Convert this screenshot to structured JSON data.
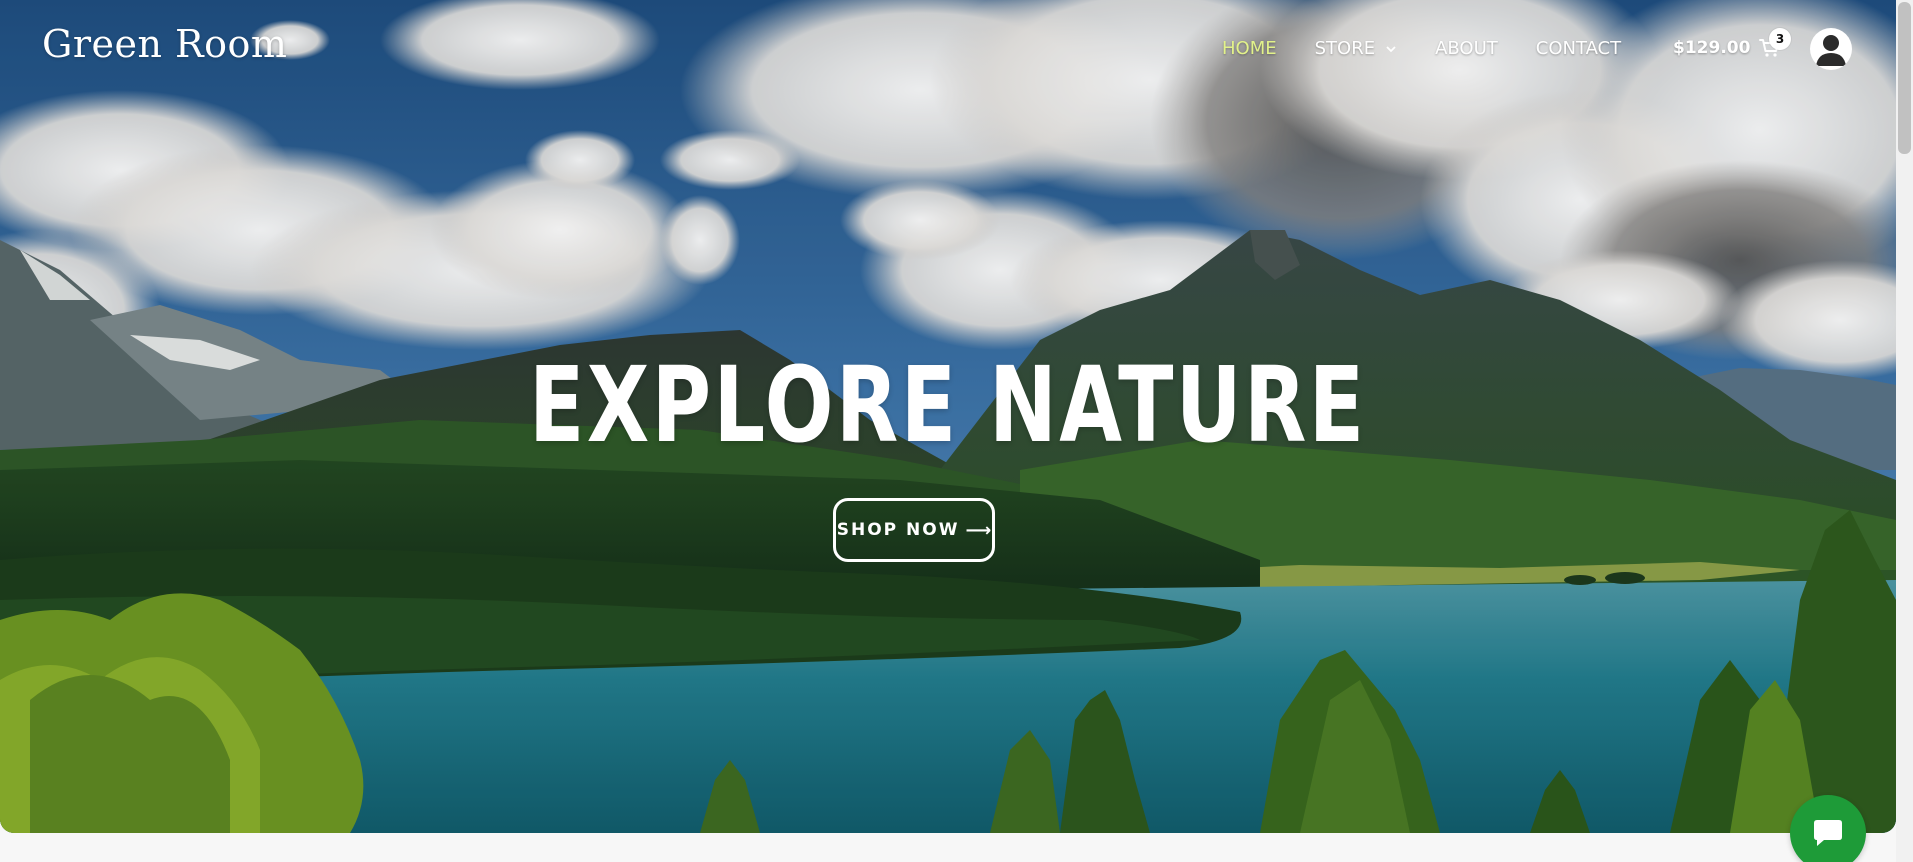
{
  "brand": {
    "name": "Green Room"
  },
  "nav": {
    "items": [
      {
        "label": "HOME",
        "active": true
      },
      {
        "label": "STORE",
        "has_dropdown": true
      },
      {
        "label": "ABOUT"
      },
      {
        "label": "CONTACT"
      }
    ]
  },
  "cart": {
    "total": "$129.00",
    "count": "3",
    "icon": "cart-icon"
  },
  "user": {
    "icon": "user-icon"
  },
  "hero": {
    "title": "EXPLORE NATURE",
    "cta_label": "SHOP NOW",
    "cta_arrow": "⟶"
  },
  "chat": {
    "icon": "chat-icon"
  },
  "colors": {
    "active_nav": "#e2f28a",
    "chat_button": "#1e9b38",
    "text": "#ffffff"
  }
}
